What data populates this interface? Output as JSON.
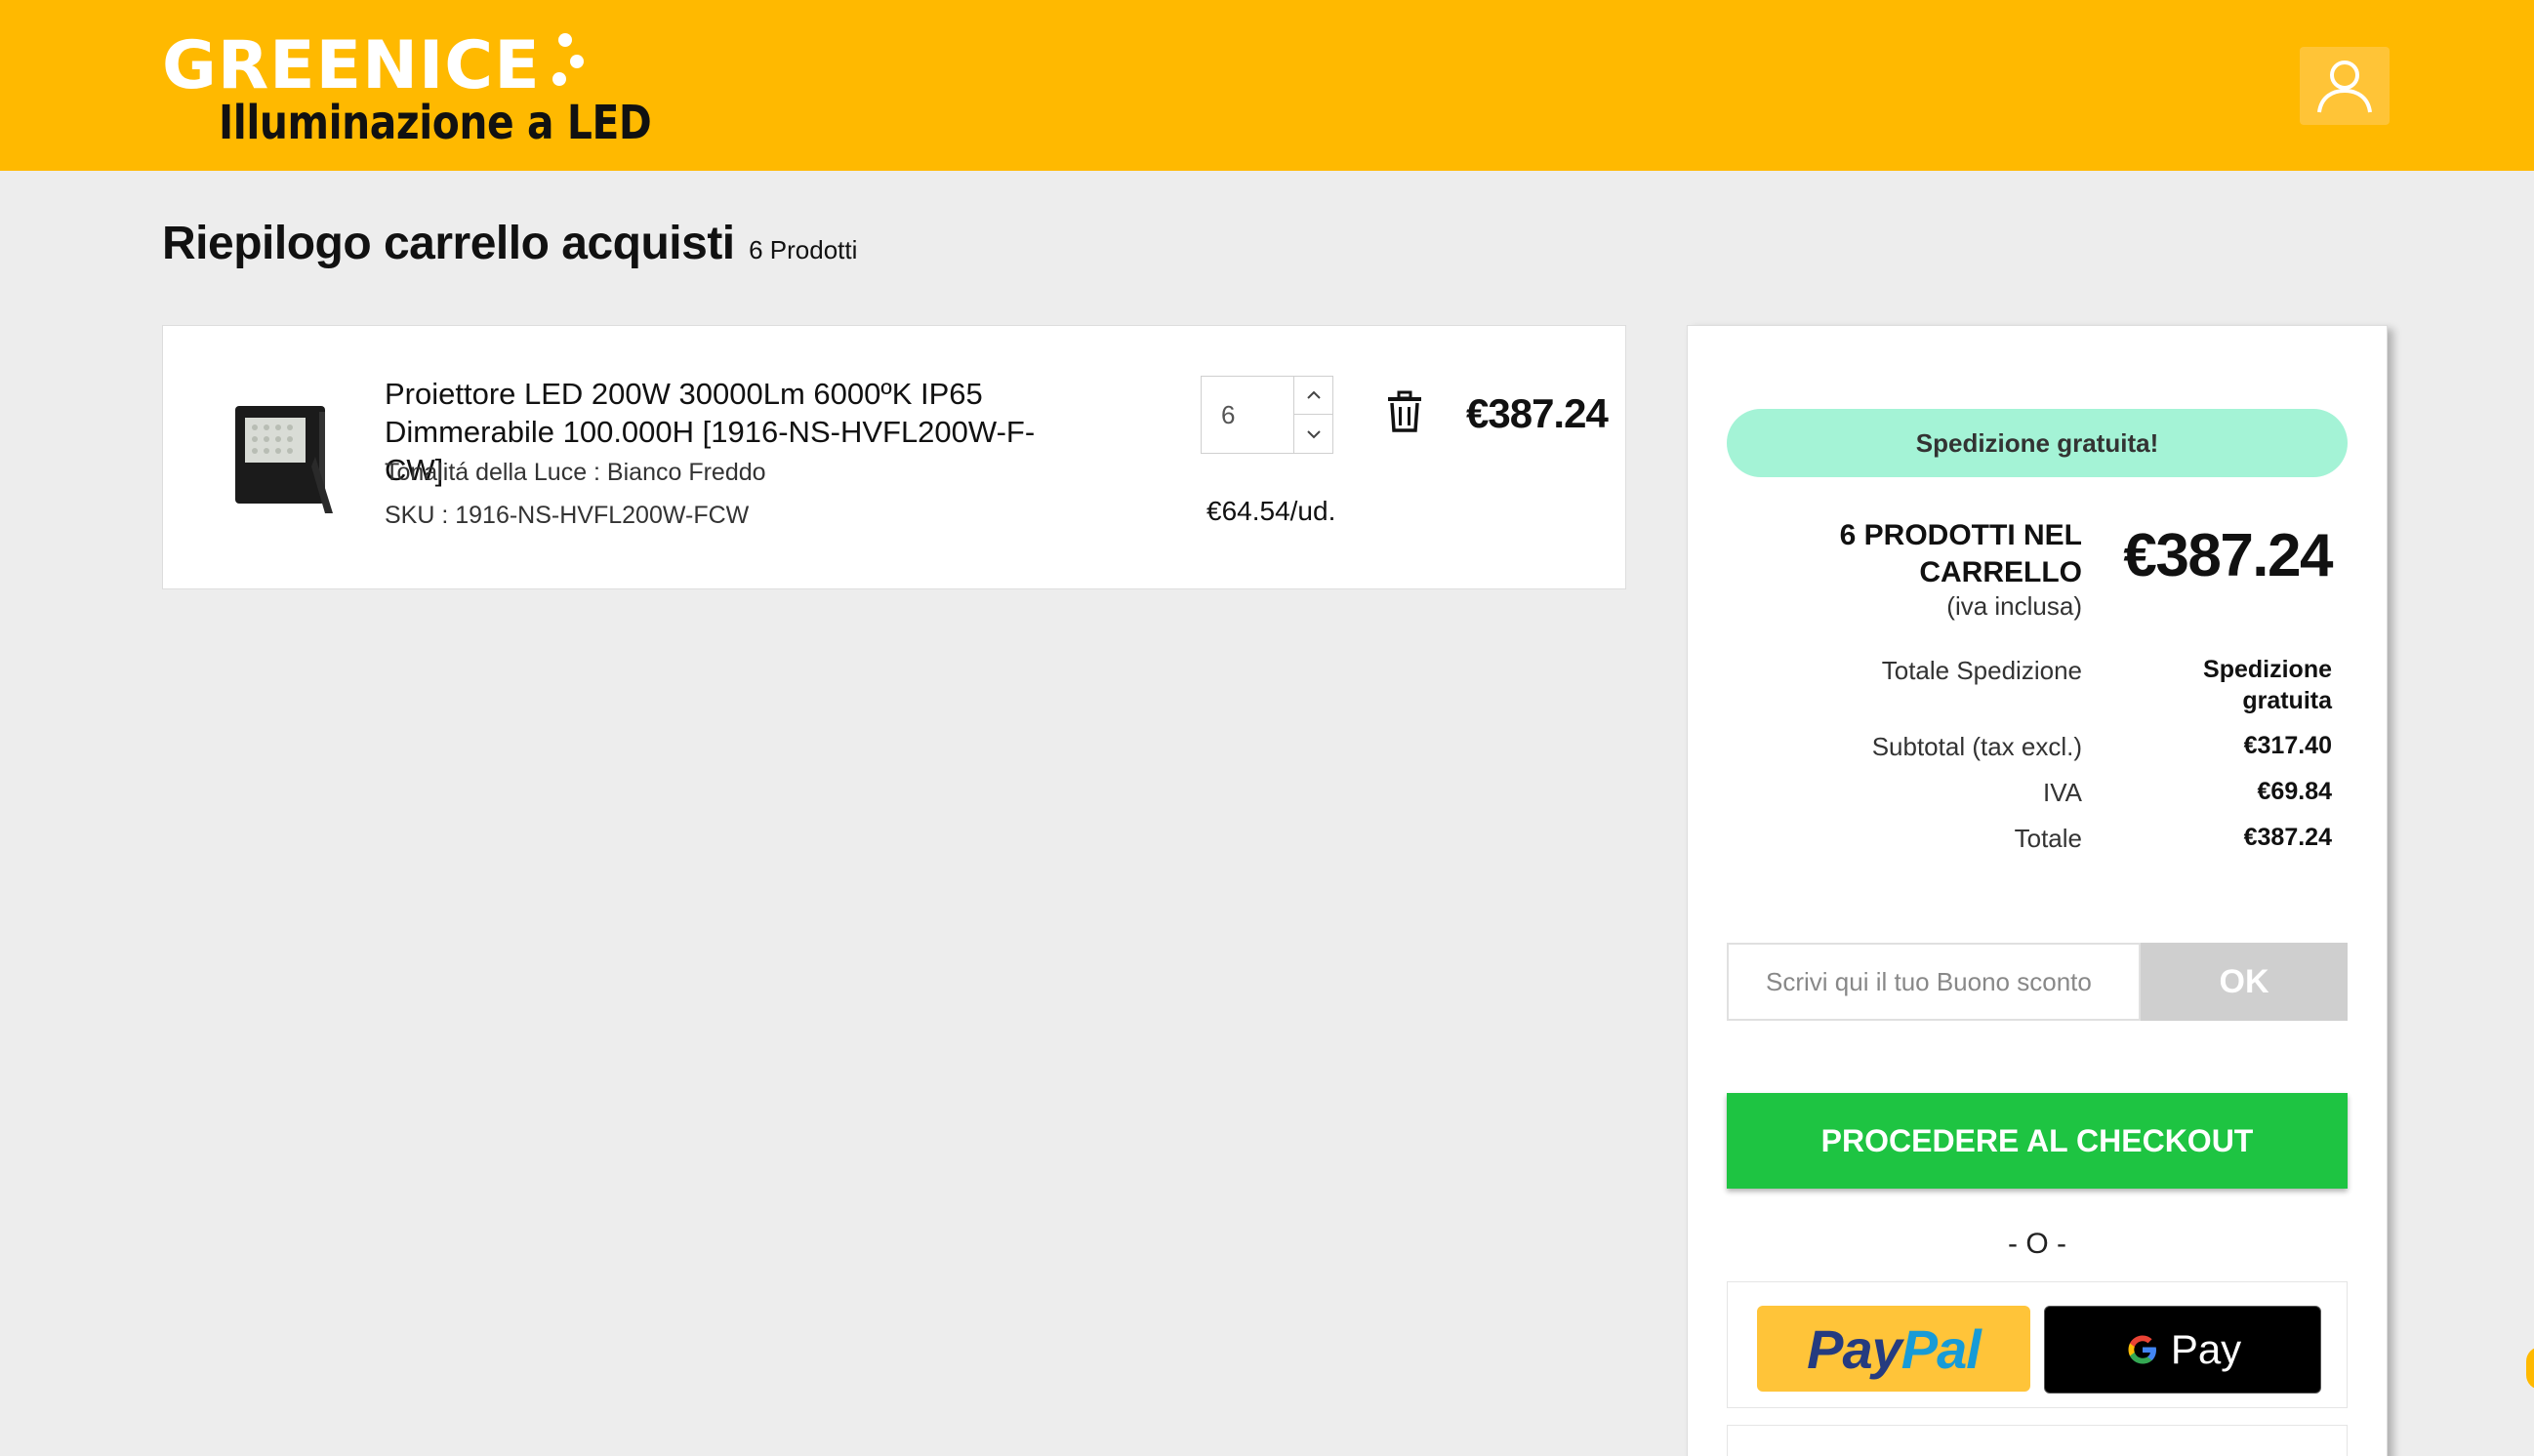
{
  "header": {
    "logo_brand": "GREENICE",
    "logo_tagline": "Illuminazione a LED",
    "account_icon": "user-icon",
    "background_color": "#ffb900"
  },
  "page": {
    "title": "Riepilogo carrello acquisti",
    "product_count": "6 Prodotti"
  },
  "cart": {
    "items": [
      {
        "image_icon": "floodlight-icon",
        "name": "Proiettore LED 200W 30000Lm 6000ºK IP65 Dimmerabile 100.000H [1916-NS-HVFL200W-F-CW]",
        "attribute": "Tonalitá della Luce : Bianco Freddo",
        "sku": "SKU : 1916-NS-HVFL200W-FCW",
        "quantity": "6",
        "unit_price": "€64.54/ud.",
        "line_total": "€387.24"
      }
    ]
  },
  "summary": {
    "shipping_banner": "Spedizione gratuita!",
    "products_in_cart": "6 PRODOTTI NEL CARRELLO",
    "tax_note": "(iva inclusa)",
    "grand_total": "€387.24",
    "rows": [
      {
        "label": "Totale Spedizione",
        "value": "Spedizione gratuita"
      },
      {
        "label": "Subtotal (tax excl.)",
        "value": "€317.40"
      },
      {
        "label": "IVA",
        "value": "€69.84"
      },
      {
        "label": "Totale",
        "value": "€387.24"
      }
    ],
    "voucher_placeholder": "Scrivi qui il tuo Buono sconto",
    "voucher_button": "OK",
    "checkout_button": "PROCEDERE AL CHECKOUT",
    "or_separator": "- O -",
    "paypal_label_1": "Pay",
    "paypal_label_2": "Pal",
    "gpay_label": "Pay",
    "colors": {
      "checkout_green": "#1ec442",
      "shipping_pill": "#a4f3d6",
      "paypal_yellow": "#ffc439"
    }
  }
}
